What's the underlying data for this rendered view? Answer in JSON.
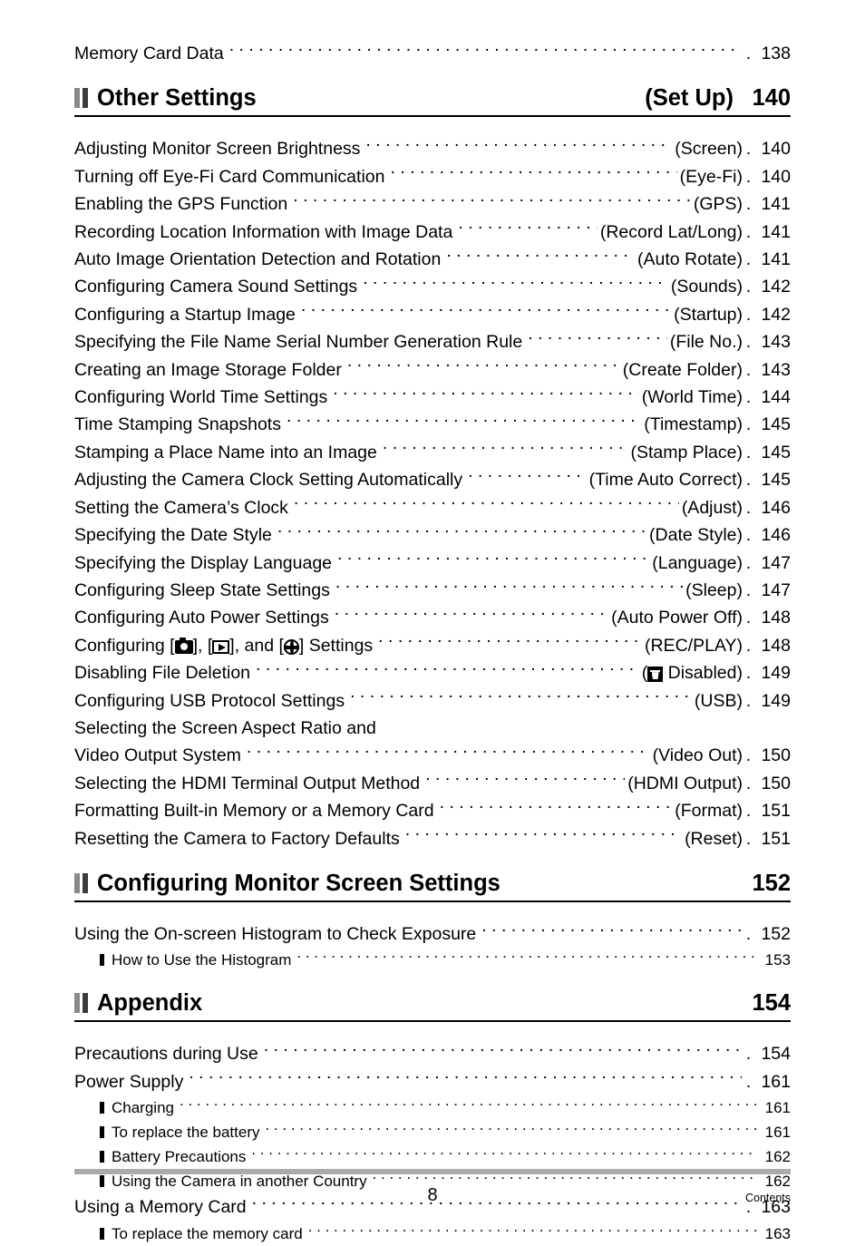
{
  "document": {
    "footer_page_number": "8",
    "footer_label": "Contents"
  },
  "top_entry": {
    "title": "Memory Card Data",
    "key": "",
    "dot": ".",
    "page": "138"
  },
  "sections": [
    {
      "marker": "section-marker-icon",
      "title": "Other Settings",
      "key": "(Set Up)",
      "page": "140",
      "entries": [
        {
          "title": "Adjusting Monitor Screen Brightness",
          "key": "(Screen)",
          "dot": ".",
          "page": "140"
        },
        {
          "title": "Turning off Eye-Fi Card Communication",
          "key": "(Eye-Fi)",
          "dot": ".",
          "page": "140"
        },
        {
          "title": "Enabling the GPS Function",
          "key": "(GPS)",
          "dot": ".",
          "page": "141"
        },
        {
          "title": "Recording Location Information with Image Data",
          "key": "(Record Lat/Long)",
          "dot": ".",
          "page": "141"
        },
        {
          "title": "Auto Image Orientation Detection and Rotation",
          "key": "(Auto Rotate)",
          "dot": ".",
          "page": "141"
        },
        {
          "title": "Configuring Camera Sound Settings",
          "key": "(Sounds)",
          "dot": ".",
          "page": "142"
        },
        {
          "title": "Configuring a Startup Image",
          "key": "(Startup)",
          "dot": ".",
          "page": "142"
        },
        {
          "title": "Specifying the File Name Serial Number Generation Rule",
          "key": "(File No.)",
          "dot": ".",
          "page": "143"
        },
        {
          "title": "Creating an Image Storage Folder",
          "key": "(Create Folder)",
          "dot": ".",
          "page": "143"
        },
        {
          "title": "Configuring World Time Settings",
          "key": "(World Time)",
          "dot": ".",
          "page": "144"
        },
        {
          "title": "Time Stamping Snapshots",
          "key": "(Timestamp)",
          "dot": ".",
          "page": "145"
        },
        {
          "title": "Stamping a Place Name into an Image",
          "key": "(Stamp Place)",
          "dot": ".",
          "page": "145"
        },
        {
          "title": "Adjusting the Camera Clock Setting Automatically",
          "key": "(Time Auto Correct)",
          "dot": ".",
          "page": "145"
        },
        {
          "title": "Setting the Camera’s Clock",
          "key": "(Adjust)",
          "dot": ".",
          "page": "146"
        },
        {
          "title": "Specifying the Date Style",
          "key": "(Date Style)",
          "dot": ".",
          "page": "146"
        },
        {
          "title": "Specifying the Display Language",
          "key": "(Language)",
          "dot": ".",
          "page": "147"
        },
        {
          "title": "Configuring Sleep State Settings",
          "key": "(Sleep)",
          "dot": ".",
          "page": "147"
        },
        {
          "title": "Configuring Auto Power Settings",
          "key": "(Auto Power Off)",
          "dot": ".",
          "page": "148"
        }
      ],
      "icon_entries": {
        "recplay": {
          "prefix": "Configuring [",
          "mid1": "], [",
          "mid2": "], and [",
          "suffix": "] Settings",
          "icons": [
            "camera-icon",
            "play-icon",
            "globe-icon"
          ],
          "key": "(REC/PLAY)",
          "dot": ".",
          "page": "148"
        },
        "delete": {
          "title": "Disabling File Deletion",
          "key_open": "(",
          "key_close": " Disabled)",
          "icon": "trash-icon",
          "dot": ".",
          "page": "149"
        }
      },
      "entries_after": [
        {
          "title": "Configuring USB Protocol Settings",
          "key": "(USB)",
          "dot": ".",
          "page": "149"
        }
      ],
      "wrapped_entry": {
        "line1": "Selecting the Screen Aspect Ratio and",
        "line2": "Video Output System",
        "key": "(Video Out)",
        "dot": ".",
        "page": "150"
      },
      "entries_tail": [
        {
          "title": "Selecting the HDMI Terminal Output Method",
          "key": "(HDMI Output)",
          "dot": ".",
          "page": "150"
        },
        {
          "title": "Formatting Built-in Memory or a Memory Card",
          "key": "(Format)",
          "dot": ".",
          "page": "151"
        },
        {
          "title": "Resetting the Camera to Factory Defaults",
          "key": "(Reset)",
          "dot": ".",
          "page": "151"
        }
      ]
    },
    {
      "marker": "section-marker-icon",
      "title": "Configuring Monitor Screen Settings",
      "key": "",
      "page": "152",
      "entries": [
        {
          "title": "Using the On-screen Histogram to Check Exposure",
          "key": "",
          "dot": ".",
          "page": "152"
        }
      ],
      "subentries": [
        {
          "title": "How to Use the Histogram",
          "page": "153"
        }
      ]
    },
    {
      "marker": "section-marker-icon",
      "title": "Appendix",
      "key": "",
      "page": "154",
      "entries": [
        {
          "title": "Precautions during Use",
          "key": "",
          "dot": ".",
          "page": "154"
        },
        {
          "title": "Power Supply",
          "key": "",
          "dot": ".",
          "page": "161"
        }
      ],
      "subentries": [
        {
          "title": "Charging",
          "page": "161"
        },
        {
          "title": "To replace the battery",
          "page": "161"
        },
        {
          "title": "Battery Precautions",
          "page": "162"
        },
        {
          "title": "Using the Camera in another Country",
          "page": "162"
        }
      ],
      "entries2": [
        {
          "title": "Using a Memory Card",
          "key": "",
          "dot": ".",
          "page": "163"
        }
      ],
      "subentries2": [
        {
          "title": "To replace the memory card",
          "page": "163"
        }
      ]
    }
  ]
}
